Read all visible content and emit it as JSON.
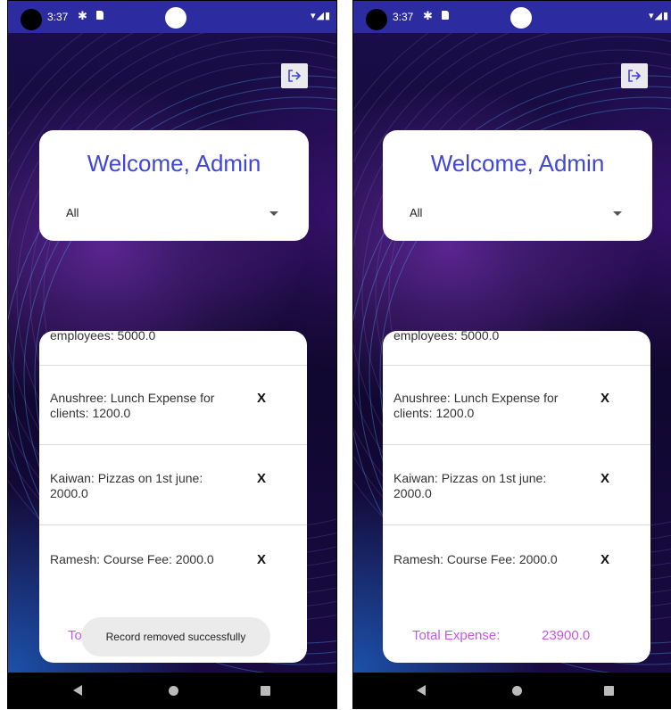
{
  "status_bar": {
    "time": "3:37"
  },
  "welcome": {
    "title": "Welcome, Admin"
  },
  "filter": {
    "selected": "All"
  },
  "expenses": [
    {
      "text": "employees: 5000.0"
    },
    {
      "text": "Anushree: Lunch Expense for clients: 1200.0",
      "delete_label": "X"
    },
    {
      "text": "Kaiwan: Pizzas on 1st june: 2000.0",
      "delete_label": "X"
    },
    {
      "text": "Ramesh: Course Fee: 2000.0",
      "delete_label": "X"
    }
  ],
  "total": {
    "label": "Total Expense:",
    "value": "23900.0"
  },
  "toast": {
    "message": "Record removed successfully"
  },
  "colors": {
    "accent": "#4146d6",
    "total_text": "#c458e0",
    "status_bar": "#2c2ca0"
  },
  "icons": {
    "logout": "logout-icon",
    "settings": "gear-icon",
    "sim": "sim-card-icon",
    "wifi": "wifi-icon",
    "signal": "signal-icon",
    "battery": "battery-icon",
    "dropdown": "chevron-down-icon",
    "back": "back-icon",
    "home": "home-icon",
    "recents": "recents-icon"
  }
}
